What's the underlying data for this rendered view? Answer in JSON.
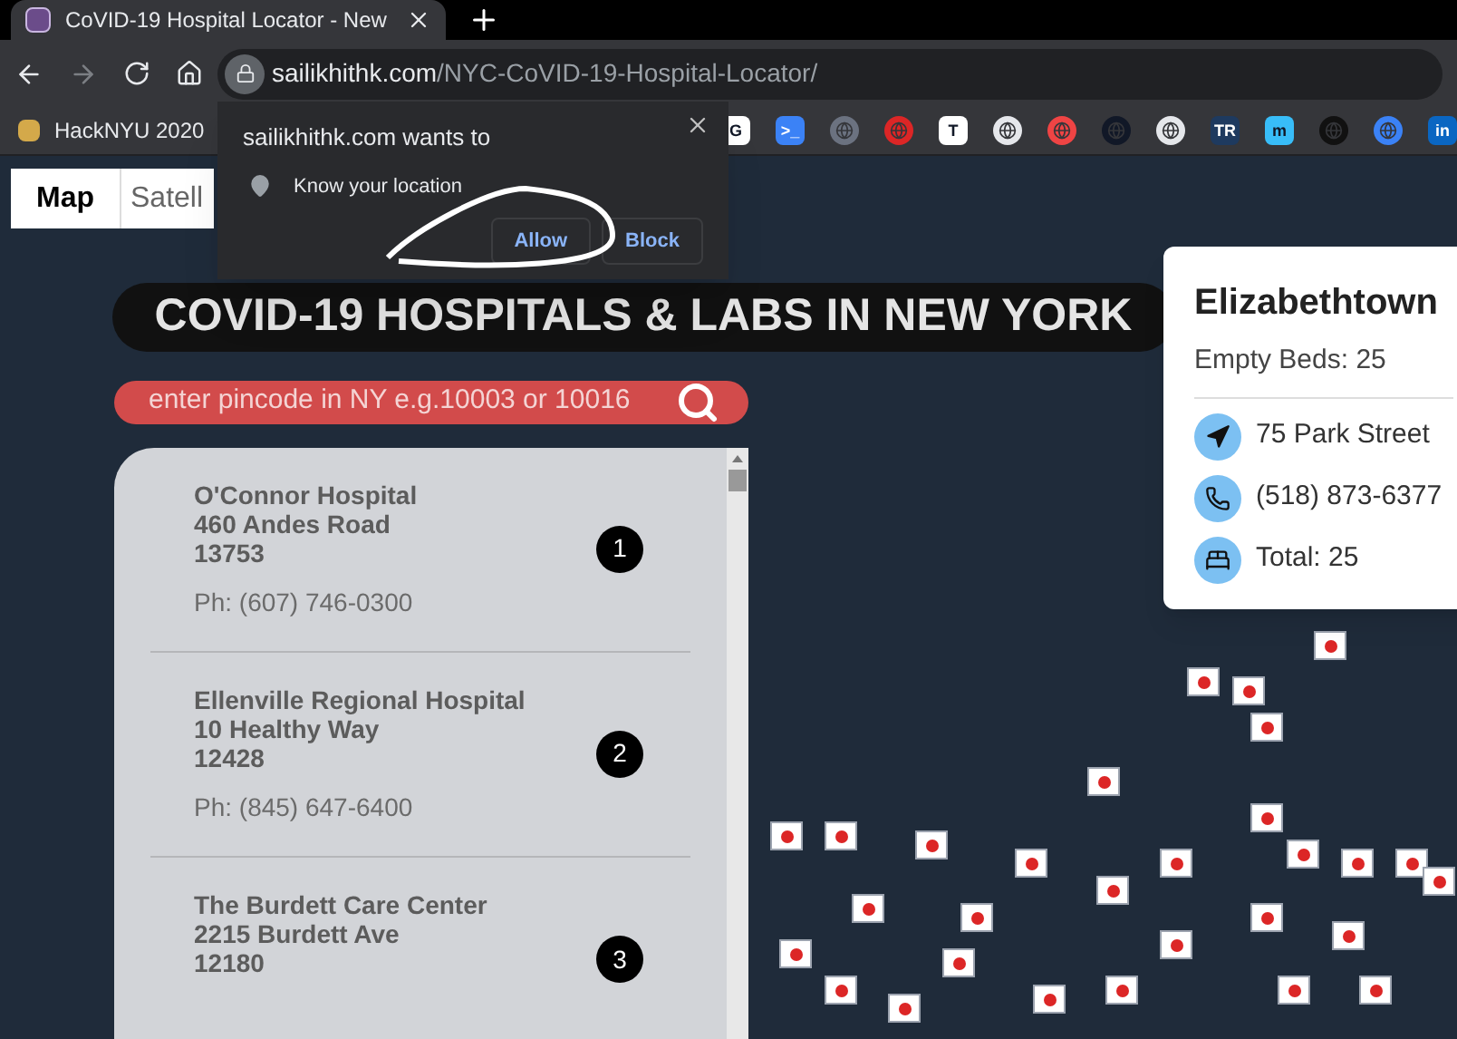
{
  "browser": {
    "tab": {
      "title": "CoVID-19 Hospital Locator - New"
    },
    "url": {
      "domain": "sailikhithk.com",
      "path": "/NYC-CoVID-19-Hospital-Locator/"
    },
    "bookmarks": [
      {
        "kind": "named",
        "label": "HackNYU 2020"
      },
      {
        "kind": "glyph",
        "label": "G",
        "color": "#ffffff"
      },
      {
        "kind": "glyph",
        "label": ">_",
        "color": "#3b82f6"
      },
      {
        "kind": "icon",
        "color": "#6b7280"
      },
      {
        "kind": "icon",
        "color": "#dc2626"
      },
      {
        "kind": "glyph",
        "label": "T",
        "color": "#ffffff"
      },
      {
        "kind": "icon",
        "color": "#e5e7eb"
      },
      {
        "kind": "icon",
        "color": "#ef4444"
      },
      {
        "kind": "icon",
        "color": "#111827"
      },
      {
        "kind": "icon",
        "color": "#e5e7eb"
      },
      {
        "kind": "glyph",
        "label": "TR",
        "color": "#1e3a5f"
      },
      {
        "kind": "glyph",
        "label": "m",
        "color": "#38bdf8"
      },
      {
        "kind": "icon",
        "color": "#111111"
      },
      {
        "kind": "icon",
        "color": "#3b82f6"
      },
      {
        "kind": "glyph",
        "label": "in",
        "color": "#0a66c2"
      }
    ]
  },
  "permission_popup": {
    "message": "sailikhithk.com wants to",
    "permission": "Know your location",
    "buttons": [
      "Allow",
      "Block"
    ]
  },
  "map_type": [
    {
      "label": "Map",
      "selected": true
    },
    {
      "label": "Satell",
      "selected": false
    }
  ],
  "banner": {
    "title": "COVID-19 HOSPITALS & LABS IN NEW YORK"
  },
  "search": {
    "placeholder": "enter pincode in NY e.g.10003 or 10016"
  },
  "hospitals": [
    {
      "number": "1",
      "name": "O'Connor Hospital",
      "address": "460 Andes Road",
      "zip": "13753",
      "phone": "Ph: (607) 746-0300"
    },
    {
      "number": "2",
      "name": "Ellenville Regional Hospital",
      "address": "10 Healthy Way",
      "zip": "12428",
      "phone": "Ph: (845) 647-6400"
    },
    {
      "number": "3",
      "name": "The Burdett Care Center",
      "address": "2215 Burdett Ave",
      "zip": "12180"
    }
  ],
  "info_card": {
    "title": "Elizabethtown",
    "empty_beds": "Empty Beds: 25",
    "rows": [
      {
        "kind": "address",
        "text": "75 Park Street"
      },
      {
        "kind": "phone",
        "text": "(518) 873-6377"
      },
      {
        "kind": "beds",
        "text": "Total: 25"
      }
    ]
  }
}
